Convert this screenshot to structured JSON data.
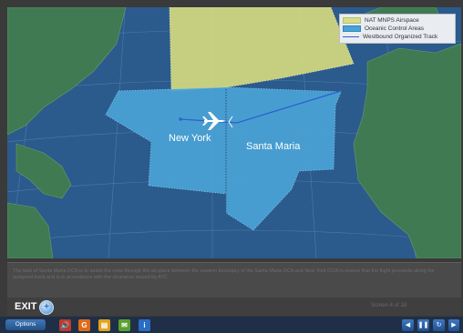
{
  "legend": {
    "items": [
      {
        "label": "NAT MNPS Airspace",
        "kind": "yellow"
      },
      {
        "label": "Oceanic Control Areas",
        "kind": "blue"
      },
      {
        "label": "Westbound Organized Track",
        "kind": "line"
      }
    ]
  },
  "map": {
    "labels": {
      "new_york": "New York",
      "santa_maria": "Santa Maria"
    },
    "colors": {
      "ocean": "#2b5a8c",
      "land": "#3f7a52",
      "mnps": "#d4d97f",
      "oca": "#4aa3d6",
      "track": "#2f5fd0"
    }
  },
  "caption": {
    "text": "The task of Santa Maria OCA is to assist the crew through the airspace between the eastern boundary of the Santa Maria OCA and New York OCA to ensure that the flight proceeds along the assigned track and is in accordance with the clearance issued by ATC."
  },
  "exit_bar": {
    "exit_label": "EXIT",
    "exit_icon": "plus-circle-icon",
    "status_text": "Screen 4 of 18"
  },
  "bottom_bar": {
    "options_label": "Options",
    "tools": [
      {
        "name": "audio-icon",
        "glyph": "🔊",
        "color": "#c0392b"
      },
      {
        "name": "glossary-icon",
        "glyph": "G",
        "color": "#e06a1a"
      },
      {
        "name": "notes-icon",
        "glyph": "▤",
        "color": "#e0a21a"
      },
      {
        "name": "chat-icon",
        "glyph": "✉",
        "color": "#5aa02c"
      },
      {
        "name": "info-icon",
        "glyph": "i",
        "color": "#2b6cc4"
      }
    ],
    "nav": [
      {
        "name": "back-icon",
        "glyph": "◀"
      },
      {
        "name": "pause-icon",
        "glyph": "❚❚"
      },
      {
        "name": "replay-icon",
        "glyph": "↻"
      },
      {
        "name": "next-icon",
        "glyph": "▶"
      }
    ]
  }
}
